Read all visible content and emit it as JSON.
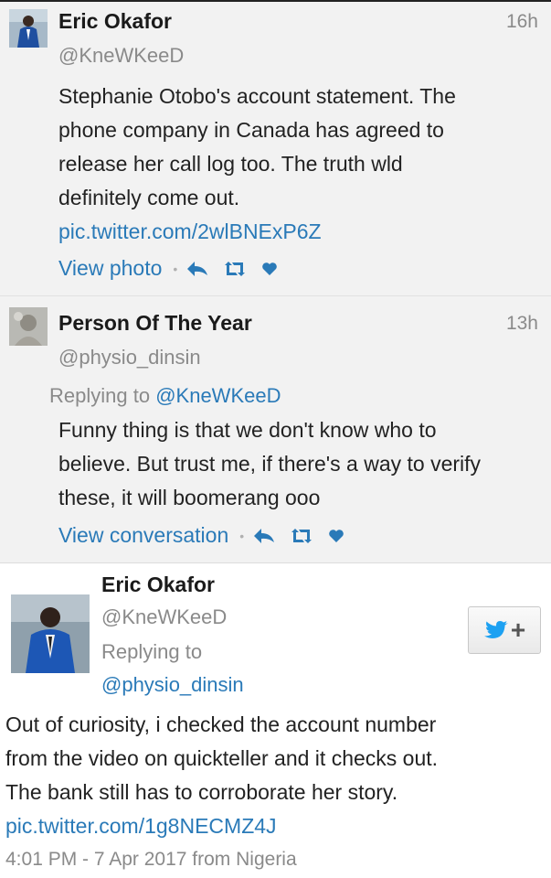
{
  "tweets": [
    {
      "name": "Eric Okafor",
      "handle": "@KneWKeeD",
      "time": "16h",
      "text_lines": [
        "Stephanie Otobo's  account statement. The",
        "phone company in Canada has agreed to",
        "release her call log too. The truth wld",
        "definitely come out."
      ],
      "link": "pic.twitter.com/2wlBNExP6Z",
      "action_label": "View photo"
    },
    {
      "name": "Person Of The Year",
      "handle": "@physio_dinsin",
      "time": "13h",
      "replying_prefix": "Replying to",
      "replying_to": "@KneWKeeD",
      "text_lines": [
        "Funny thing is that we don't  know who to",
        "believe. But trust me, if there's  a way to verify",
        "these, it will boomerang ooo"
      ],
      "action_label": "View conversation"
    }
  ],
  "main_tweet": {
    "name": "Eric Okafor",
    "handle": "@KneWKeeD",
    "replying_prefix": "Replying to",
    "replying_to": "@physio_dinsin",
    "follow_label": "+",
    "text_lines": [
      "Out of curiosity, i checked the account number",
      "from the video on quickteller and it checks out.",
      "The bank still has to corroborate her story."
    ],
    "link": "pic.twitter.com/1g8NECMZ4J",
    "meta": "4:01  PM - 7 Apr 2017 from Nigeria"
  },
  "icons": [
    "reply-icon",
    "retweet-icon",
    "like-icon",
    "twitter-bird-icon"
  ],
  "colors": {
    "link": "#2a7ab8",
    "twitter_blue": "#1da1f2",
    "muted": "#8a8a8a"
  }
}
